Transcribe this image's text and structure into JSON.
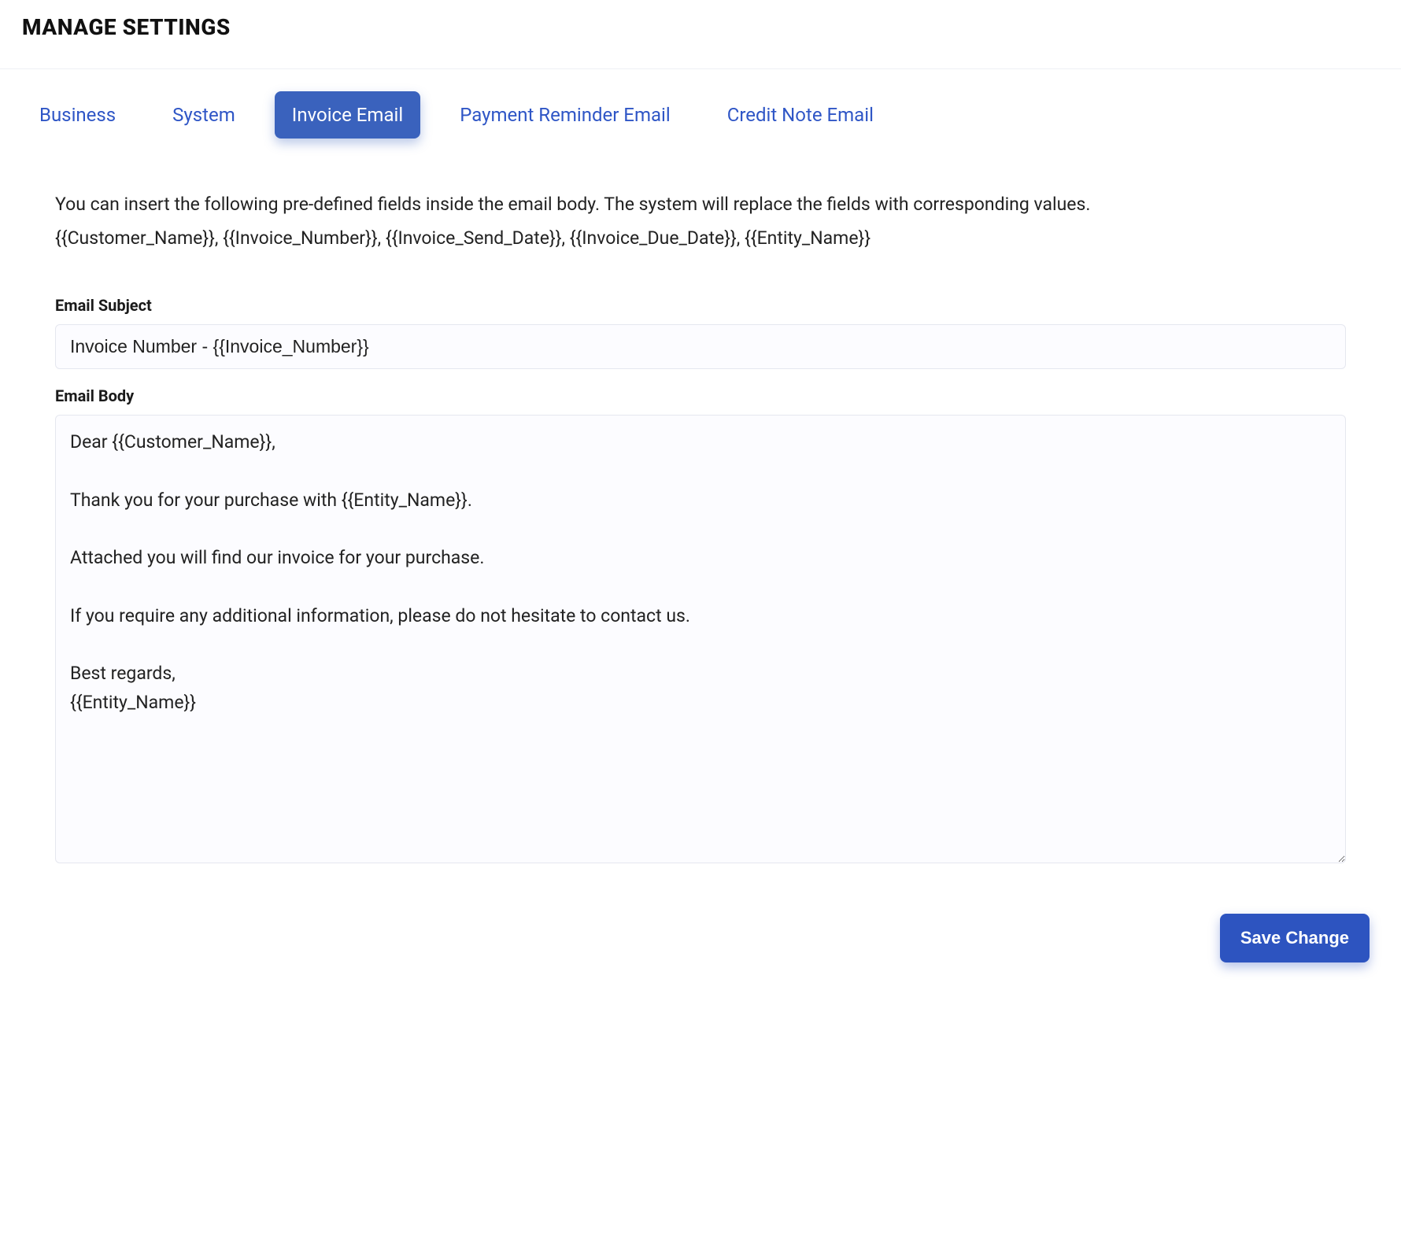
{
  "header": {
    "title": "MANAGE SETTINGS"
  },
  "tabs": {
    "business": "Business",
    "system": "System",
    "invoice_email": "Invoice Email",
    "payment_reminder_email": "Payment Reminder Email",
    "credit_note_email": "Credit Note Email",
    "active": "invoice_email"
  },
  "intro_text": "You can insert the following pre-defined fields inside the email body. The system will replace the fields with corresponding values.",
  "placeholders_text": "{{Customer_Name}}, {{Invoice_Number}}, {{Invoice_Send_Date}}, {{Invoice_Due_Date}}, {{Entity_Name}}",
  "form": {
    "subject_label": "Email Subject",
    "subject_value": "Invoice Number - {{Invoice_Number}}",
    "body_label": "Email Body",
    "body_value": "Dear {{Customer_Name}},\n\nThank you for your purchase with {{Entity_Name}}.\n\nAttached you will find our invoice for your purchase.\n\nIf you require any additional information, please do not hesitate to contact us.\n\nBest regards,\n{{Entity_Name}}"
  },
  "actions": {
    "save_label": "Save Change"
  }
}
